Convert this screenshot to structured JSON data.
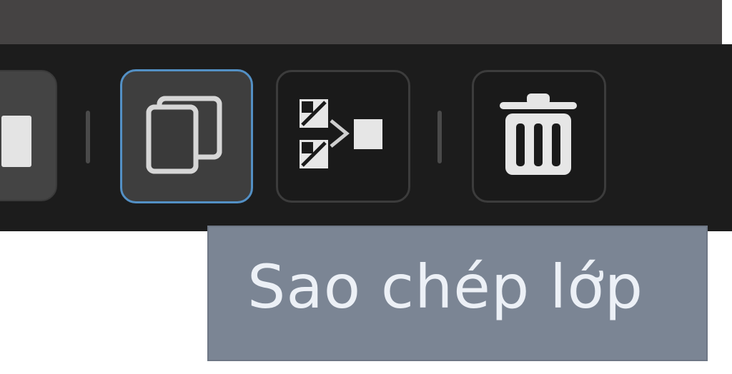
{
  "toolbar": {
    "buttons": [
      {
        "name": "partial-button",
        "icon": "rectangle-icon"
      },
      {
        "name": "duplicate-layer-button",
        "icon": "duplicate-layer-icon",
        "state": "focused"
      },
      {
        "name": "merge-layer-button",
        "icon": "merge-layer-icon"
      },
      {
        "name": "delete-layer-button",
        "icon": "trash-icon"
      }
    ]
  },
  "tooltip": {
    "text": "Sao chép lớp"
  },
  "colors": {
    "toolbar_bg": "#1c1c1c",
    "focus_border": "#5390c5",
    "tooltip_bg": "#7b8594",
    "tooltip_text": "#ecf0f6"
  }
}
